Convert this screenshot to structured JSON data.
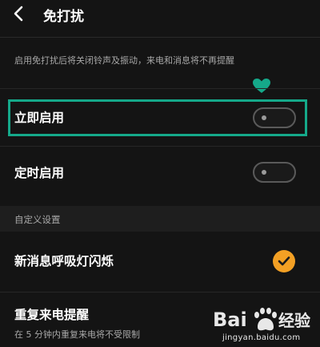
{
  "header": {
    "title": "免打扰",
    "back_icon": "chevron-left-icon"
  },
  "description": "启用免打扰后将关闭铃声及振动，来电和消息将不再提醒",
  "settings": [
    {
      "label": "立即启用",
      "control": "toggle",
      "enabled": false,
      "highlighted": true
    },
    {
      "label": "定时启用",
      "control": "toggle",
      "enabled": false
    }
  ],
  "section": {
    "title": "自定义设置"
  },
  "custom_settings": [
    {
      "label": "新消息呼吸灯闪烁",
      "control": "checkbox",
      "checked": true
    },
    {
      "label": "重复来电提醒",
      "sublabel": "在 5 分钟内重复来电将不受限制"
    }
  ],
  "annotations": {
    "heart_icon": "heart-icon",
    "highlight_color": "#15a98a"
  },
  "watermark": {
    "logo": "Bai 经验",
    "url": "jingyan.baidu.com"
  },
  "colors": {
    "background": "#141414",
    "accent": "#f3a024",
    "highlight": "#15a98a",
    "secondary_text": "#a8a8a8"
  }
}
